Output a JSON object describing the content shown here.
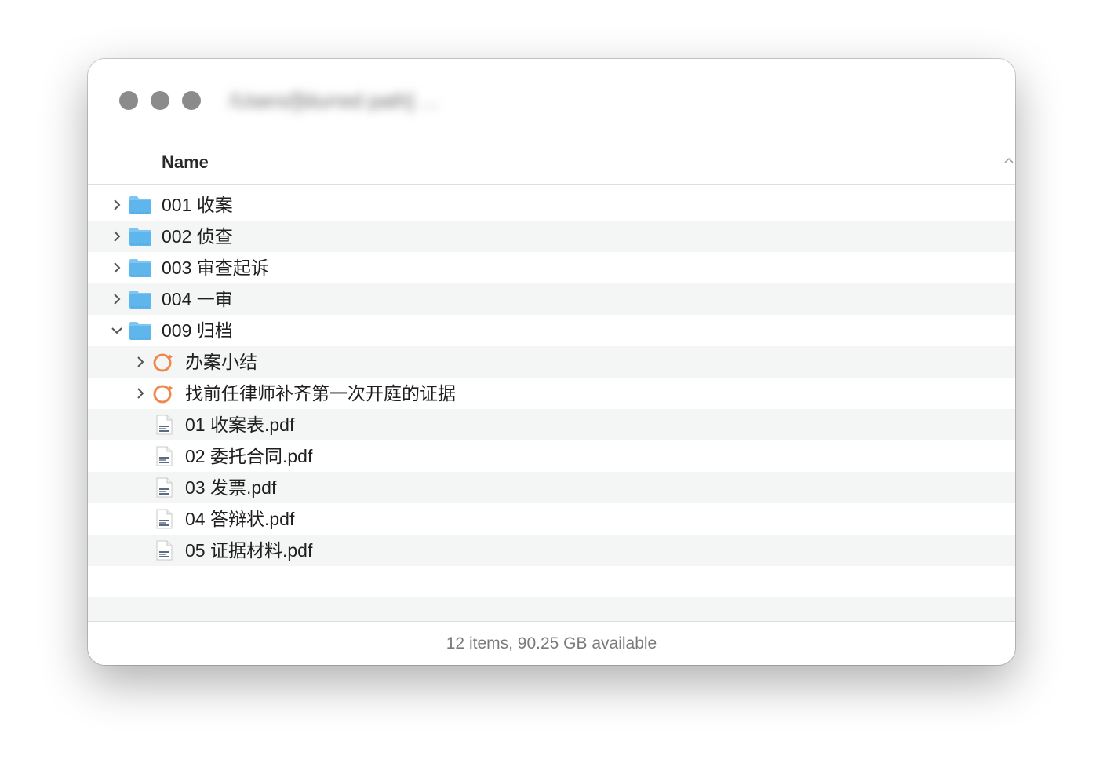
{
  "window": {
    "title": "/Users/[blurred path] …"
  },
  "header": {
    "name_column": "Name"
  },
  "rows": [
    {
      "label": "001 收案",
      "kind": "folder",
      "expand": "collapsed",
      "level": 0
    },
    {
      "label": "002 侦查",
      "kind": "folder",
      "expand": "collapsed",
      "level": 0
    },
    {
      "label": "003 审查起诉",
      "kind": "folder",
      "expand": "collapsed",
      "level": 0
    },
    {
      "label": "004 一审",
      "kind": "folder",
      "expand": "collapsed",
      "level": 0
    },
    {
      "label": "009 归档",
      "kind": "folder",
      "expand": "expanded",
      "level": 0
    },
    {
      "label": "办案小结",
      "kind": "ring",
      "expand": "collapsed",
      "level": 1
    },
    {
      "label": "找前任律师补齐第一次开庭的证据",
      "kind": "ring",
      "expand": "collapsed",
      "level": 1
    },
    {
      "label": "01 收案表.pdf",
      "kind": "pdf",
      "expand": "none",
      "level": 1
    },
    {
      "label": "02 委托合同.pdf",
      "kind": "pdf",
      "expand": "none",
      "level": 1
    },
    {
      "label": "03 发票.pdf",
      "kind": "pdf",
      "expand": "none",
      "level": 1
    },
    {
      "label": "04 答辩状.pdf",
      "kind": "pdf",
      "expand": "none",
      "level": 1
    },
    {
      "label": "05 证据材料.pdf",
      "kind": "pdf",
      "expand": "none",
      "level": 1
    },
    {
      "label": "",
      "kind": "empty",
      "expand": "none",
      "level": 0
    },
    {
      "label": "",
      "kind": "empty",
      "expand": "none",
      "level": 0
    }
  ],
  "footer": {
    "status": "12 items, 90.25 GB available"
  },
  "colors": {
    "folder": "#5fb6ec",
    "folder_tab": "#7ec6f2",
    "ring": "#f0884e",
    "traffic_light": "#8b8b8b"
  }
}
